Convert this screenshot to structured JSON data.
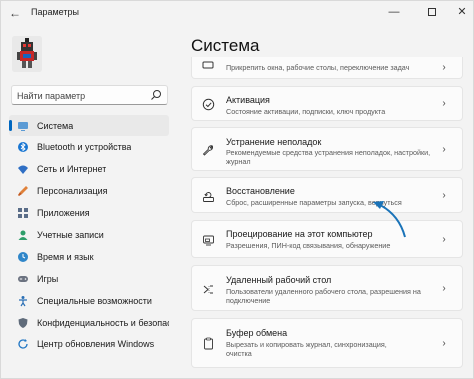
{
  "window": {
    "title": "Параметры",
    "back_icon": "arrow-left-icon",
    "controls": [
      "minimize-icon",
      "maximize-icon",
      "close-icon"
    ]
  },
  "search": {
    "placeholder": "Найти параметр"
  },
  "sidebar": {
    "items": [
      {
        "label": "Система",
        "icon": "monitor-icon",
        "active": true
      },
      {
        "label": "Bluetooth и устройства",
        "icon": "bluetooth-icon"
      },
      {
        "label": "Сеть и Интернет",
        "icon": "wifi-icon"
      },
      {
        "label": "Персонализация",
        "icon": "brush-icon"
      },
      {
        "label": "Приложения",
        "icon": "apps-icon"
      },
      {
        "label": "Учетные записи",
        "icon": "person-icon"
      },
      {
        "label": "Время и язык",
        "icon": "globe-clock-icon"
      },
      {
        "label": "Игры",
        "icon": "gamepad-icon"
      },
      {
        "label": "Специальные возможности",
        "icon": "accessibility-icon"
      },
      {
        "label": "Конфиденциальность и безопас",
        "icon": "shield-icon"
      },
      {
        "label": "Центр обновления Windows",
        "icon": "update-icon"
      }
    ]
  },
  "main": {
    "title": "Система",
    "cards": [
      {
        "title": "",
        "desc": "Прикрепить окна, рабочие столы, переключение задач",
        "icon": "multitasking-icon"
      },
      {
        "title": "Активация",
        "desc": "Состояние активации, подписки, ключ продукта",
        "icon": "check-circle-icon"
      },
      {
        "title": "Устранение неполадок",
        "desc": "Рекомендуемые средства устранения неполадок, настройки, журнал",
        "desc2": "журнал",
        "icon": "wrench-icon"
      },
      {
        "title": "Восстановление",
        "desc": "Сброс, расширенные параметры запуска, вернуться",
        "icon": "recovery-icon"
      },
      {
        "title": "Проецирование на этот компьютер",
        "desc": "Разрешения, ПИН-код связывания, обнаружение",
        "icon": "projection-icon"
      },
      {
        "title": "Удаленный рабочий стол",
        "desc": "Пользователи удаленного рабочего стола, разрешения на подключение",
        "icon": "remote-desktop-icon"
      },
      {
        "title": "Буфер обмена",
        "desc": "Вырезать и копировать журнал, синхронизация, очистка",
        "icon": "clipboard-icon"
      }
    ],
    "troubleshoot_desc_line1": "Рекомендуемые средства устранения неполадок, настройки,",
    "troubleshoot_desc_line2": "журнал",
    "remote_desc_line1": "Пользователи удаленного рабочего стола, разрешения на",
    "remote_desc_line2": "подключение",
    "clipboard_desc_line1": "Вырезать и копировать журнал, синхронизация,",
    "clipboard_desc_line2": "очистка"
  },
  "colors": {
    "accent": "#0067c0",
    "annotation_arrow": "#1a73b8"
  }
}
